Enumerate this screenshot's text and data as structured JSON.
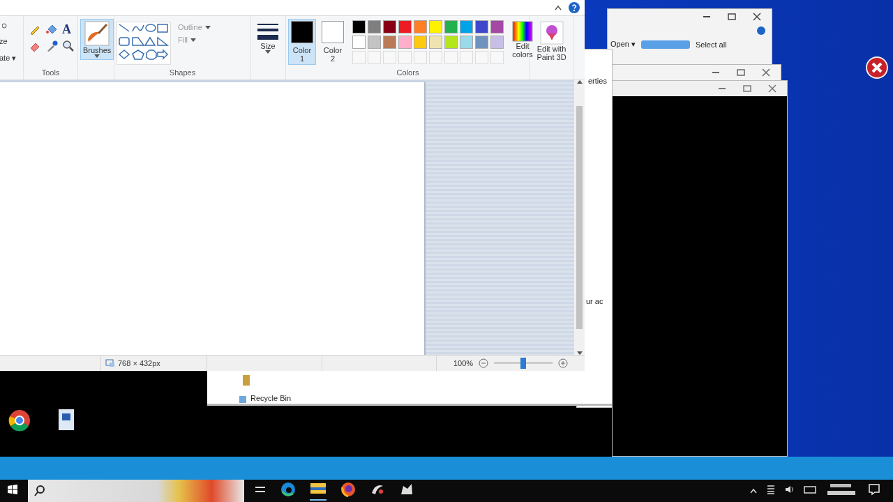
{
  "paint": {
    "ribbon": {
      "image_labels": [
        "ze",
        "ate ▾"
      ],
      "tools_label": "Tools",
      "text_tool": "A",
      "brushes": {
        "label": "Brushes",
        "selected": true
      },
      "outline": "Outline",
      "fill": "Fill",
      "shapes_label": "Shapes",
      "size": "Size",
      "color_slots": [
        {
          "label": "Color 1",
          "selected": true,
          "color": "#000000"
        },
        {
          "label": "Color 2",
          "selected": false,
          "color": "#ffffff"
        }
      ],
      "palette": [
        {
          "color": "#000000"
        },
        {
          "color": "#7f7f7f"
        },
        {
          "color": "#880015"
        },
        {
          "color": "#ed1c24"
        },
        {
          "color": "#ff7f27"
        },
        {
          "color": "#fff200"
        },
        {
          "color": "#22b14c"
        },
        {
          "color": "#00a2e8"
        },
        {
          "color": "#3f48cc"
        },
        {
          "color": "#a349a4"
        },
        {
          "color": "#ffffff"
        },
        {
          "color": "#c3c3c3"
        },
        {
          "color": "#b97a57"
        },
        {
          "color": "#ffaec9"
        },
        {
          "color": "#ffc90e"
        },
        {
          "color": "#efe4b0"
        },
        {
          "color": "#b5e61d"
        },
        {
          "color": "#99d9ea"
        },
        {
          "color": "#7092be"
        },
        {
          "color": "#c8bfe7"
        }
      ],
      "colors_label": "Colors",
      "edit_colors": "Edit colors",
      "paint3d": "Edit with Paint 3D"
    },
    "status_bar": {
      "dimensions": "768 × 432px",
      "zoom": "100%",
      "level": 0.5
    }
  },
  "background_windows": {
    "toolbar": [
      "Open ▾",
      "Select all"
    ],
    "side_texts": [
      "erties",
      "ur ac"
    ],
    "recycle_bin": "Recycle Bin"
  }
}
